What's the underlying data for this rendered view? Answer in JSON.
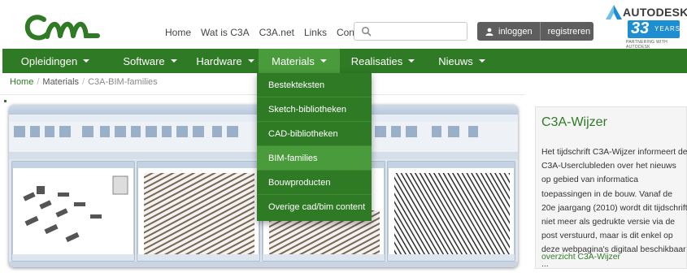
{
  "header": {
    "nav": [
      "Home",
      "Wat is C3A",
      "C3A.net",
      "Links",
      "Contact"
    ],
    "search_placeholder": "",
    "login_label": "inloggen",
    "register_label": "registreren"
  },
  "autodesk": {
    "brand": "AUTODESK",
    "years_number": "33",
    "years_label": "YEARS",
    "partner_text": "PARTNERING WITH AUTODESK"
  },
  "mainnav": {
    "items": [
      {
        "label": "Opleidingen"
      },
      {
        "label": "Software"
      },
      {
        "label": "Hardware"
      },
      {
        "label": "Materials"
      },
      {
        "label": "Realisaties"
      },
      {
        "label": "Nieuws"
      }
    ],
    "active_index": 3
  },
  "breadcrumb": {
    "home": "Home",
    "section": "Materials",
    "current": "C3A-BIM-families"
  },
  "dropdown": {
    "items": [
      "Bestekteksten",
      "Sketch-bibliotheken",
      "CAD-bibliotheken",
      "BIM-families",
      "Bouwproducten",
      "Overige cad/bim content"
    ],
    "selected_index": 3
  },
  "sidebar": {
    "title": "C3A-Wijzer",
    "body": "Het tijdschrift C3A-Wijzer informeert de C3A-Userclubleden over het nieuws op gebied van informatica toepassingen in de bouw. Vanaf de 20e jaargang (2010) wordt dit tijdschrift niet meer als gedrukte versie via de post verstuurd, maar is dit enkel op deze webpagina's digitaal beschikbaar ...",
    "link": "overzicht C3A-Wijzer"
  },
  "colors": {
    "brand_green": "#2f7a25",
    "active_green": "#4a9b3b",
    "auth_gray": "#5e5e5e",
    "autodesk_blue": "#1e8ed0"
  }
}
